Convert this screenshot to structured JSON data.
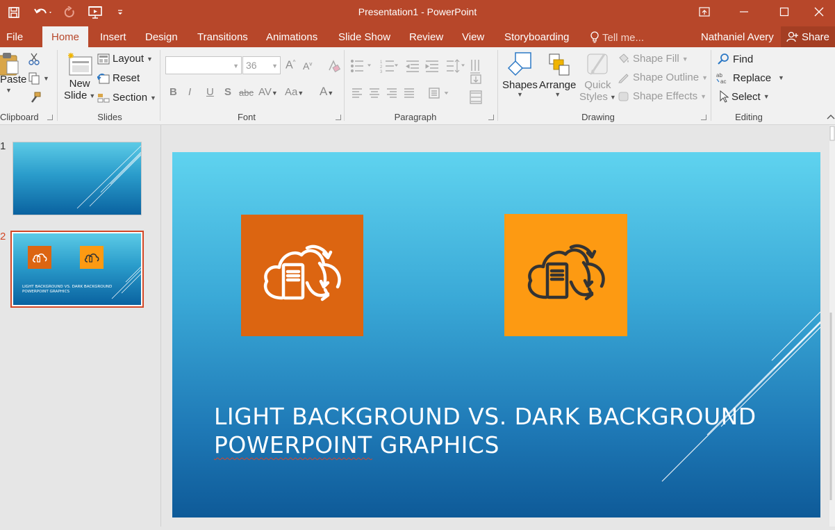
{
  "app": {
    "window_title": "Presentation1 - PowerPoint"
  },
  "qat": {
    "icons": [
      "save-icon",
      "undo-icon",
      "redo-icon",
      "present-from-start-icon",
      "customize-qat-icon"
    ]
  },
  "tabs": {
    "file": "File",
    "home": "Home",
    "insert": "Insert",
    "design": "Design",
    "transitions": "Transitions",
    "animations": "Animations",
    "slideshow": "Slide Show",
    "review": "Review",
    "view": "View",
    "storyboarding": "Storyboarding",
    "tellme": "Tell me...",
    "user": "Nathaniel Avery",
    "share": "Share"
  },
  "ribbon": {
    "clipboard": {
      "paste": "Paste",
      "label": "Clipboard"
    },
    "slides": {
      "new_slide_1": "New",
      "new_slide_2": "Slide",
      "layout": "Layout",
      "reset": "Reset",
      "section": "Section",
      "label": "Slides"
    },
    "font": {
      "size": "36",
      "bold": "B",
      "italic": "I",
      "underline": "U",
      "shadow": "S",
      "strike": "abc",
      "spacing": "AV",
      "case": "Aa",
      "color": "A",
      "label": "Font"
    },
    "paragraph": {
      "label": "Paragraph"
    },
    "drawing": {
      "shapes": "Shapes",
      "arrange": "Arrange",
      "quick_1": "Quick",
      "quick_2": "Styles",
      "fill": "Shape Fill",
      "outline": "Shape Outline",
      "effects": "Shape Effects",
      "label": "Drawing"
    },
    "editing": {
      "find": "Find",
      "replace": "Replace",
      "select": "Select",
      "label": "Editing"
    }
  },
  "thumbnails": [
    {
      "number": "1"
    },
    {
      "number": "2",
      "title_l1": "LIGHT BACKGROUND VS. DARK BACKGROUND",
      "title_l2": "POWERPOINT GRAPHICS"
    }
  ],
  "slide": {
    "title_line1": "LIGHT BACKGROUND VS. DARK BACKGROUND",
    "title_line2_word1": "POWERPOINT",
    "title_line2_word2": " GRAPHICS",
    "tile_colors": {
      "dark_tile": "#dc6511",
      "light_tile": "#fd9a12"
    }
  },
  "colors": {
    "accent": "#b7472a",
    "ribbon_bg": "#f1f1f1",
    "selected_thumb_border": "#d24726"
  }
}
